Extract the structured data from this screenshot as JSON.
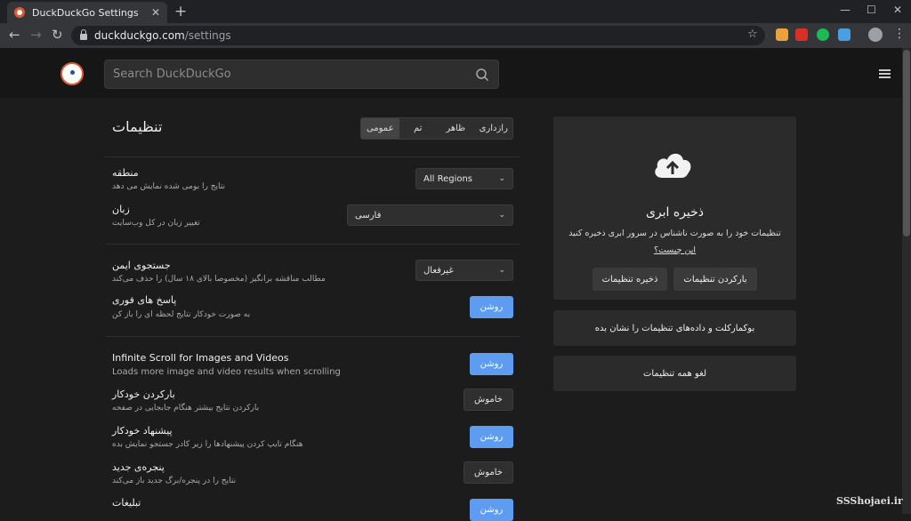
{
  "browser": {
    "tab_title": "DuckDuckGo Settings",
    "tab_close": "✕",
    "new_tab": "+",
    "minimize": "—",
    "maximize": "☐",
    "close": "✕",
    "back": "←",
    "forward": "→",
    "reload": "↻",
    "url_host": "duckduckgo.com",
    "url_path": "/settings",
    "star": "☆",
    "kebab": "⋮"
  },
  "header": {
    "search_placeholder": "Search DuckDuckGo"
  },
  "settings": {
    "title": "تنظیمات",
    "tabs": [
      "رازداری",
      "ظاهر",
      "تم",
      "عمومی"
    ],
    "active_tab": "عمومی",
    "region": {
      "label": "منطقه",
      "desc": "نتایج را بومی شده نمایش می دهد",
      "value": "All Regions"
    },
    "language": {
      "label": "زبان",
      "desc": "تغییر زبان در کل وب‌سایت",
      "value": "فارسی"
    },
    "safe_search": {
      "label": "جستجوی ایمن",
      "desc": "مطالب مناقشه برانگیز (مخصوصا بالای ۱۸ سال) را حذف می‌کند",
      "value": "غیرفعال"
    },
    "instant_answers": {
      "label": "پاسخ های فوری",
      "desc": "به صورت خودکار نتایج لحظه ای را باز کن",
      "state": "روشن"
    },
    "infinite_scroll": {
      "label": "Infinite Scroll for Images and Videos",
      "desc": "Loads more image and video results when scrolling",
      "state": "روشن"
    },
    "auto_load": {
      "label": "بارکردن خودکار",
      "desc": "بارکردن نتایج بیشتر هنگام جابجایی در صفحه",
      "state": "خاموش"
    },
    "autosuggest": {
      "label": "پیشنهاد خودکار",
      "desc": "هنگام تایپ کردن پیشنهادها را زیر کادر جستجو نمایش بده",
      "state": "روشن"
    },
    "new_window": {
      "label": "پنجره‌ی جدید",
      "desc": "نتایج را در پنجره/برگ جدید باز می‌کند",
      "state": "خاموش"
    },
    "ads": {
      "label": "تبلیغات",
      "state": "روشن"
    }
  },
  "cloud": {
    "title": "ذخیره ابری",
    "desc": "تنظیمات خود را به صورت ناشناس در سرور ابری ذخیره کنید",
    "link": "این چیست؟",
    "load_button": "بارکردن تنظیمات",
    "save_button": "ذخیره تنظیمات"
  },
  "side_buttons": {
    "bookmarklet": "بوکمارکلت و داده‌های تنظیمات را نشان بده",
    "reset": "لغو همه تنظیمات"
  },
  "watermark": "SSShojaei.ir",
  "colors": {
    "accent": "#5e9cf2",
    "ddg_orange": "#de5833",
    "background": "#1c1c1c",
    "card": "#2b2b2b"
  }
}
